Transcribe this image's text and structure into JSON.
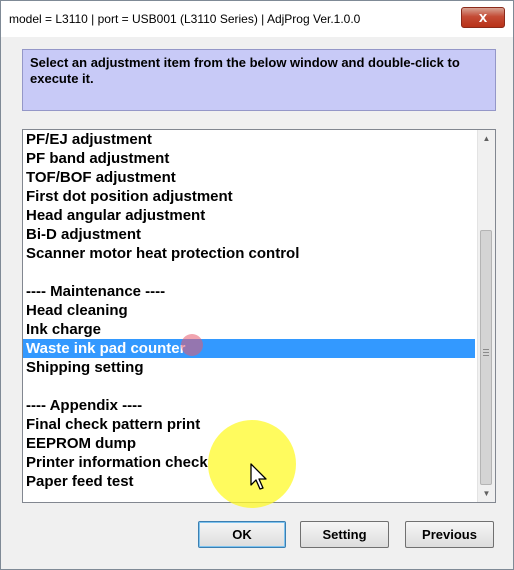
{
  "window": {
    "title": "model = L3110 | port = USB001 (L3110 Series) | AdjProg Ver.1.0.0",
    "close_label": "x"
  },
  "instructions": "Select an adjustment item from the below window and double-click to execute it.",
  "list": {
    "items": [
      "PF/EJ adjustment",
      "PF band adjustment",
      "TOF/BOF adjustment",
      "First dot position adjustment",
      "Head angular adjustment",
      "Bi-D adjustment",
      "Scanner motor heat protection control",
      "",
      "---- Maintenance ----",
      "Head cleaning",
      "Ink charge",
      "Waste ink pad counter",
      "Shipping setting",
      "",
      "---- Appendix ----",
      "Final check pattern print",
      "EEPROM dump",
      "Printer information check",
      "Paper feed test"
    ],
    "selected_index": 11
  },
  "buttons": {
    "ok": "OK",
    "setting": "Setting",
    "previous": "Previous"
  },
  "colors": {
    "selection": "#3399ff",
    "info_box": "#c8caf7",
    "close_button": "#c44b35",
    "cursor_highlight": "#fff828"
  },
  "icons": {
    "close": "close-icon",
    "scroll_up": "scroll-up-arrow-icon",
    "scroll_down": "scroll-down-arrow-icon",
    "cursor": "mouse-pointer-icon"
  }
}
